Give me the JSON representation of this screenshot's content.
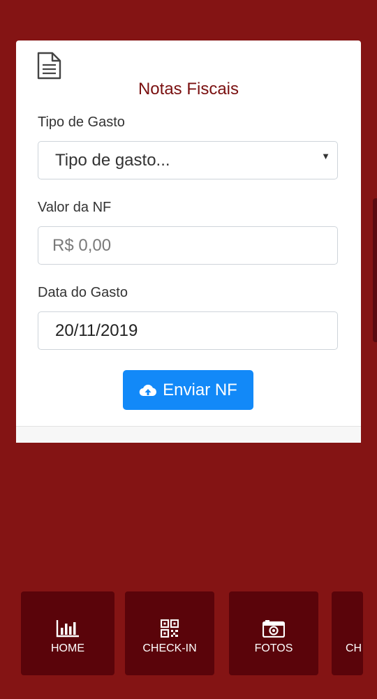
{
  "card": {
    "title": "Notas Fiscais",
    "icon": "document-icon"
  },
  "form": {
    "tipo_label": "Tipo de Gasto",
    "tipo_value": "Tipo de gasto...",
    "valor_label": "Valor da NF",
    "valor_placeholder": "R$ 0,00",
    "data_label": "Data do Gasto",
    "data_value": "20/11/2019",
    "submit_label": "Enviar NF"
  },
  "nav": {
    "items": [
      {
        "label": "HOME",
        "icon": "bar-chart-icon"
      },
      {
        "label": "CHECK-IN",
        "icon": "qr-code-icon"
      },
      {
        "label": "FOTOS",
        "icon": "camera-icon"
      },
      {
        "label": "CH",
        "icon": ""
      }
    ]
  },
  "colors": {
    "background": "#841414",
    "title": "#7a1010",
    "button": "#1289f8",
    "nav_tile": "#5a040a"
  }
}
